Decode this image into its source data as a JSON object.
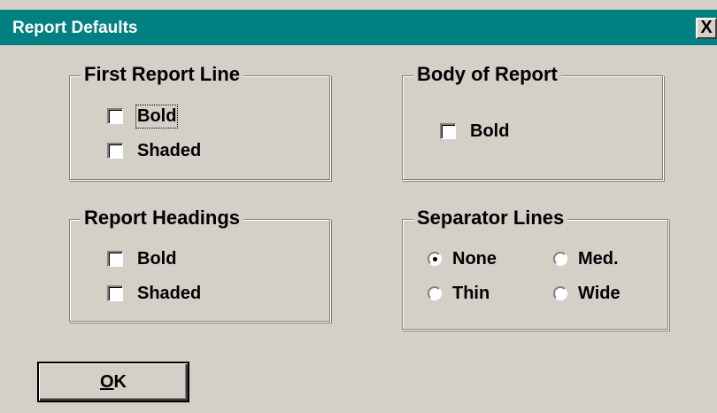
{
  "window": {
    "title": "Report Defaults",
    "close_glyph": "X"
  },
  "first_report_line": {
    "legend": "First Report Line",
    "bold": {
      "label": "Bold",
      "checked": false,
      "focused": true
    },
    "shaded": {
      "label": "Shaded",
      "checked": false
    }
  },
  "body_of_report": {
    "legend": "Body of Report",
    "bold": {
      "label": "Bold",
      "checked": false
    }
  },
  "report_headings": {
    "legend": "Report Headings",
    "bold": {
      "label": "Bold",
      "checked": false
    },
    "shaded": {
      "label": "Shaded",
      "checked": false
    }
  },
  "separator_lines": {
    "legend": "Separator Lines",
    "options": [
      {
        "label": "None",
        "selected": true
      },
      {
        "label": "Med.",
        "selected": false
      },
      {
        "label": "Thin",
        "selected": false
      },
      {
        "label": "Wide",
        "selected": false
      }
    ]
  },
  "ok_button": {
    "mnemonic": "O",
    "rest": "K"
  },
  "colors": {
    "titlebar": "#008080",
    "face": "#d4d0c8"
  }
}
